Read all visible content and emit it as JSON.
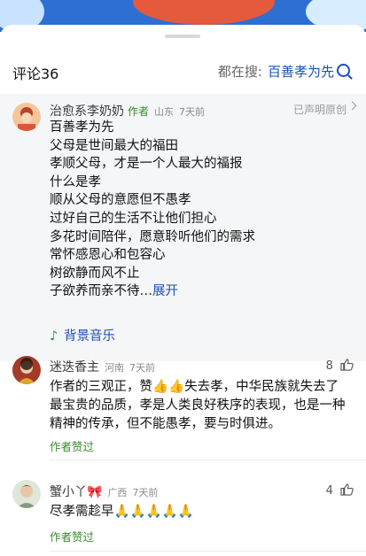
{
  "header": {
    "comment_count_label": "评论36",
    "search_prefix": "都在搜:",
    "search_query": "百善孝为先"
  },
  "pinned_comment": {
    "author": "治愈系李奶奶",
    "author_tag": "作者",
    "location": "山东",
    "time": "7天前",
    "original_badge": "已声明原创",
    "lines": [
      "百善孝为先",
      "父母是世间最大的福田",
      "孝顺父母，才是一个人最大的福报",
      "什么是孝",
      "顺从父母的意愿但不愚孝",
      "过好自己的生活不让他们担心",
      "多花时间陪伴，愿意聆听他们的需求",
      "常怀感恩心和包容心",
      "树欲静而风不止",
      "子欲养而亲不待…"
    ],
    "expand_label": "展开",
    "music_label": "背景音乐"
  },
  "comments": [
    {
      "author": "迷迭香主",
      "location": "河南",
      "time": "7天前",
      "likes": "8",
      "text": "作者的三观正，赞👍👍失去孝，中华民族就失去了最宝贵的品质，孝是人类良好秩序的表现，也是一种精神的传承，但不能愚孝，要与时俱进。",
      "author_liked": "作者赞过"
    },
    {
      "author": "蟹小丫🎀",
      "location": "广西",
      "time": "7天前",
      "likes": "4",
      "text": "尽孝需趁早🙏🙏🙏🙏🙏",
      "author_liked": "作者赞过"
    }
  ],
  "colors": {
    "accent_blue": "#1f4fb6",
    "author_green": "#3a8a2f",
    "pinned_bg": "#f5f6f8"
  }
}
